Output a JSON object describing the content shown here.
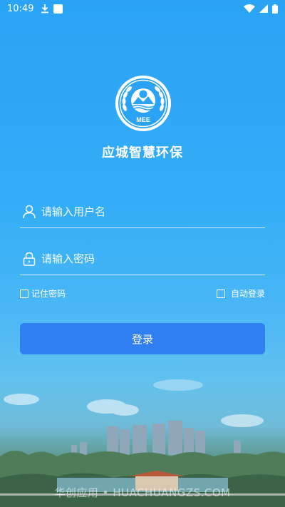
{
  "status_bar": {
    "time": "10:49"
  },
  "app": {
    "title": "应城智慧环保",
    "logo_text": "MEE"
  },
  "login": {
    "username_placeholder": "请输入用户名",
    "password_placeholder": "请输入密码",
    "remember_label": "记住密码",
    "auto_login_label": "自动登录",
    "submit_label": "登录"
  },
  "watermark": "华创应用 • HUACHUANGZS.COM",
  "colors": {
    "accent_button": "#2f7ff0",
    "background_top": "#2aa3f5"
  }
}
